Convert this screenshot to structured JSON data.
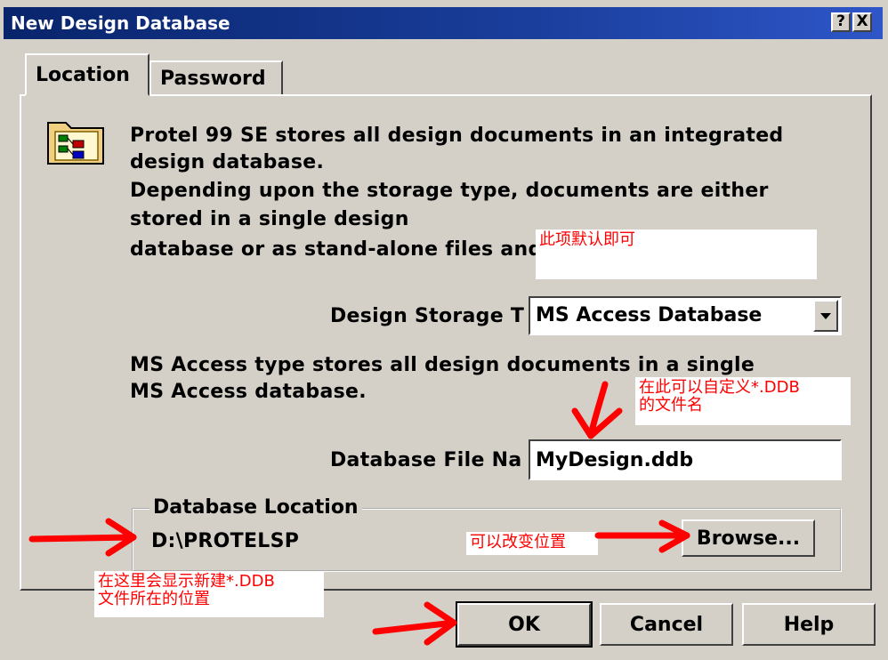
{
  "window": {
    "title": "New Design Database",
    "help_btn": "?",
    "close_btn": "X"
  },
  "tabs": [
    {
      "label": "Location"
    },
    {
      "label": "Password"
    }
  ],
  "intro": {
    "line1": "Protel 99 SE stores all design documents in an integrated",
    "line2": "design database.",
    "line3": "Depending upon the storage type, documents are either",
    "line4": "stored in a single design",
    "line5": "database or as stand-alone files and"
  },
  "storage_type": {
    "label": "Design Storage T",
    "value": "MS Access Database"
  },
  "storage_desc": {
    "line1": "MS Access type stores all design documents in a single",
    "line2": "MS Access database."
  },
  "file_name": {
    "label": "Database File Na",
    "value": "MyDesign.ddb"
  },
  "location": {
    "group_label": "Database Location",
    "path": "D:\\PROTELSP",
    "browse_label": "Browse..."
  },
  "buttons": {
    "ok": "OK",
    "cancel": "Cancel",
    "help": "Help"
  },
  "annotations": {
    "default_note": "此项默认即可",
    "filename_note_1": "在此可以自定义*.DDB",
    "filename_note_2": "的文件名",
    "browse_note": "可以改变位置",
    "location_note_1": "在这里会显示新建*.DDB",
    "location_note_2": "文件所在的位置"
  },
  "colors": {
    "annotation": "#ff0000",
    "titlebar": "#08246b",
    "face": "#d4d0c8"
  }
}
